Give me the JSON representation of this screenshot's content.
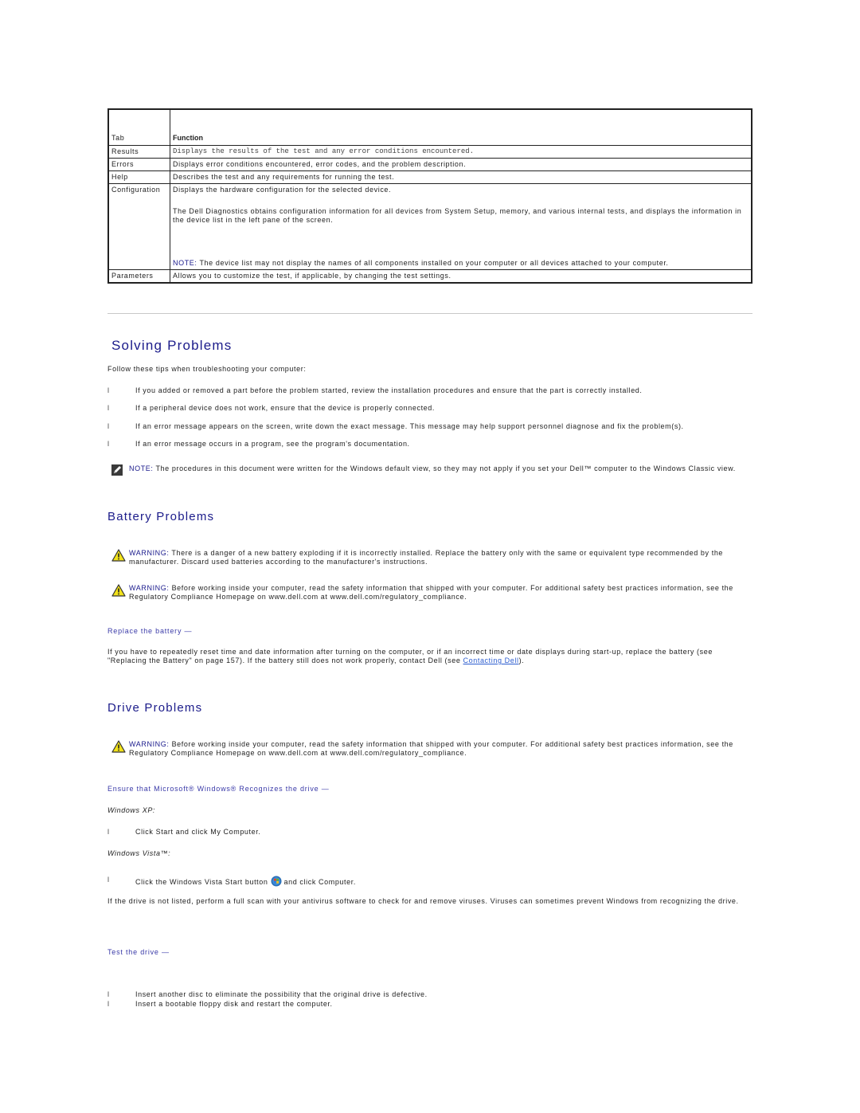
{
  "table": {
    "headers": {
      "tab": "Tab",
      "function": "Function"
    },
    "rows": [
      {
        "tab": "Results",
        "function": "Displays the results of the test and any error conditions encountered."
      },
      {
        "tab": "Errors",
        "function": "Displays error conditions encountered, error codes, and the problem description."
      },
      {
        "tab": "Help",
        "function": "Describes the test and any requirements for running the test."
      },
      {
        "tab": "Configuration",
        "function": "Displays the hardware configuration for the selected device.",
        "function_2": "The Dell Diagnostics obtains configuration information for all devices from System Setup, memory, and various internal tests, and displays the information in the device list in the left pane of the screen.",
        "note_label": "NOTE:",
        "note_text": " The device list may not display the names of all components installed on your computer or all devices attached to your computer."
      },
      {
        "tab": "Parameters",
        "function": "Allows you to customize the test, if applicable, by changing the test settings."
      }
    ]
  },
  "solving": {
    "title": "Solving Problems",
    "intro": "Follow these tips when troubleshooting your computer:",
    "bullet_glyph": "l",
    "tips": [
      "If you added or removed a part before the problem started, review the installation procedures and ensure that the part is correctly installed.",
      "If a peripheral device does not work, ensure that the device is properly connected.",
      "If an error message appears on the screen, write down the exact message. This message may help support personnel diagnose and fix the problem(s).",
      "If an error message occurs in a program, see the program's documentation."
    ],
    "note_label": "NOTE:",
    "note_text": " The procedures in this document were written for the Windows default view, so they may not apply if you set your Dell™ computer to the Windows Classic view."
  },
  "battery": {
    "title": "Battery Problems",
    "warning1_label": "WARNING:",
    "warning1_text": " There is a danger of a new battery exploding if it is incorrectly installed. Replace the battery only with the same or equivalent type recommended by the manufacturer. Discard used batteries according to the manufacturer's instructions.",
    "warning2_label": "WARNING:",
    "warning2_text": " Before working inside your computer, read the safety information that shipped with your computer. For additional safety best practices information, see the Regulatory Compliance Homepage on www.dell.com at www.dell.com/regulatory_compliance.",
    "subhead": "Replace the battery —",
    "para_before_link": "If you have to repeatedly reset time and date information after turning on the computer, or if an incorrect time or date displays during start-up, replace the battery (see \"Replacing the Battery\" on page 157). If the battery still does not work properly, contact Dell (see ",
    "link": "Contacting Dell",
    "para_after_link": ")."
  },
  "drive": {
    "title": "Drive Problems",
    "warning_label": "WARNING:",
    "warning_text": " Before working inside your computer, read the safety information that shipped with your computer. For additional safety best practices information, see the Regulatory Compliance Homepage on www.dell.com at www.dell.com/regulatory_compliance.",
    "subhead1": "Ensure that Microsoft® Windows® Recognizes the drive —",
    "xp_label": "Windows XP:",
    "xp_step": "Click Start and click My Computer.",
    "vista_label": "Windows Vista™:",
    "vista_step_before": "Click the Windows Vista Start button",
    "vista_step_after": "and click Computer.",
    "scan_para": "If the drive is not listed, perform a full scan with your antivirus software to check for and remove viruses. Viruses can sometimes prevent Windows from recognizing the drive.",
    "subhead2": "Test the drive —",
    "test_steps": [
      "Insert another disc to eliminate the possibility that the original drive is defective.",
      "Insert a bootable floppy disk and restart the computer."
    ]
  }
}
